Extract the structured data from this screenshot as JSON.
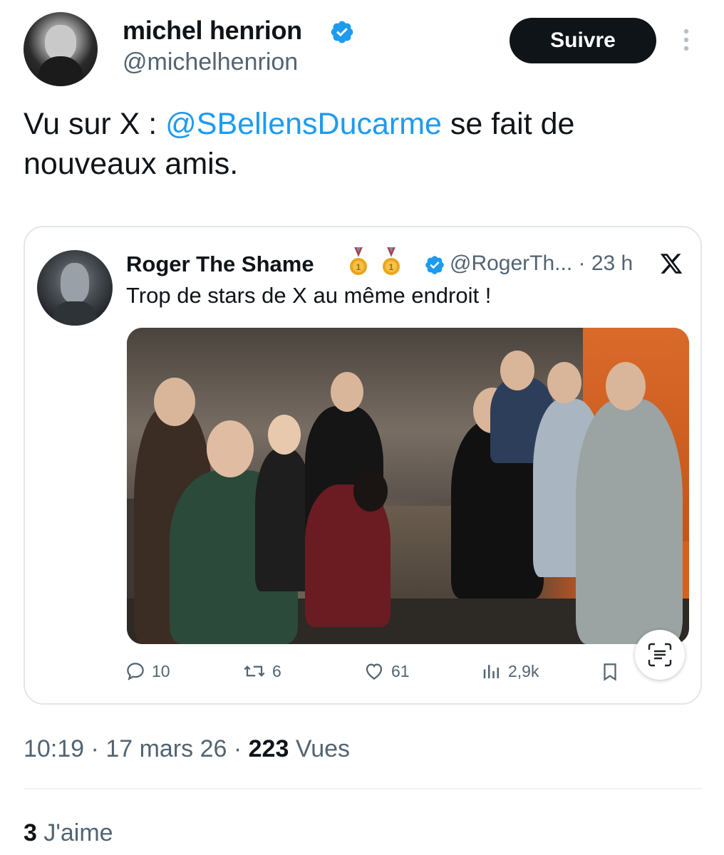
{
  "tweet": {
    "author_name": "michel henrion",
    "author_handle": "@michelhenrion",
    "follow_label": "Suivre",
    "text_before": "Vu sur X : ",
    "mention": "@SBellensDucarme",
    "text_after": " se fait de nouveaux amis.",
    "time": "10:19",
    "date": "17 mars 26",
    "views_count": "223",
    "views_label": "Vues",
    "likes_count": "3",
    "likes_label": "J'aime"
  },
  "quote": {
    "author_name": "Roger The Shame",
    "author_handle": "@RogerTh...",
    "time_ago": "· 23 h",
    "text": "Trop de stars de X au même endroit !",
    "replies": "10",
    "reposts": "6",
    "likes": "61",
    "views": "2,9k"
  },
  "icons": {
    "verified": "verified-badge-icon",
    "more": "more-vertical-icon",
    "x_logo": "x-logo-icon",
    "medal": "gold-medal-icon",
    "reply": "reply-icon",
    "repost": "repost-icon",
    "like": "heart-icon",
    "views": "views-chart-icon",
    "bookmark": "bookmark-icon",
    "scan": "text-scan-icon"
  },
  "colors": {
    "accent": "#1d9bf0",
    "text": "#0f1419",
    "secondary": "#536471",
    "medal": "#e9a51b"
  }
}
